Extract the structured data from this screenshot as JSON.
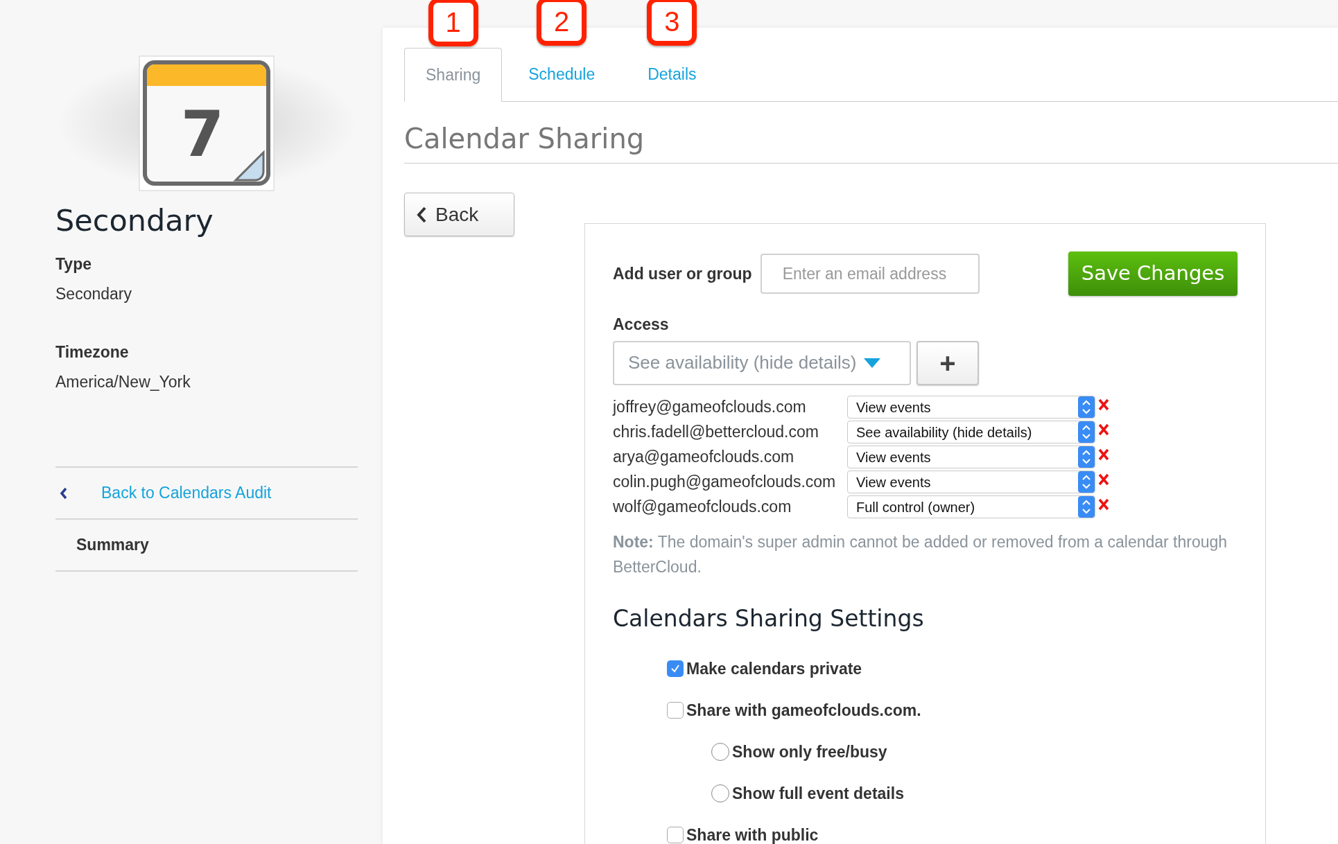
{
  "sidebar": {
    "icon_day": "7",
    "title": "Secondary",
    "fields": [
      {
        "label": "Type",
        "value": "Secondary"
      },
      {
        "label": "Timezone",
        "value": "America/New_York"
      }
    ],
    "nav": [
      {
        "kind": "back",
        "label": "Back to Calendars Audit"
      },
      {
        "kind": "item",
        "label": "Summary"
      }
    ]
  },
  "tabs": [
    {
      "label": "Sharing",
      "step": "1",
      "selected": true
    },
    {
      "label": "Schedule",
      "step": "2",
      "selected": false
    },
    {
      "label": "Details",
      "step": "3",
      "selected": false
    }
  ],
  "heading": "Calendar Sharing",
  "back_button": "Back",
  "form": {
    "add_label": "Add user or group",
    "email_placeholder": "Enter an email address",
    "save_button": "Save Changes",
    "access_label": "Access",
    "access_value": "See availability (hide details)",
    "add_button": "+",
    "shares": [
      {
        "email": "joffrey@gameofclouds.com",
        "access": "View events"
      },
      {
        "email": "chris.fadell@bettercloud.com",
        "access": "See availability (hide details)"
      },
      {
        "email": "arya@gameofclouds.com",
        "access": "View events"
      },
      {
        "email": "colin.pugh@gameofclouds.com",
        "access": "View events"
      },
      {
        "email": "wolf@gameofclouds.com",
        "access": "Full control (owner)"
      }
    ],
    "note": "**Note:** The domain's super admin cannot be added or removed from a calendar through BetterCloud.",
    "settings_title": "Calendars Sharing Settings",
    "settings": [
      {
        "kind": "checkbox",
        "label": "Make calendars private",
        "checked": true
      },
      {
        "kind": "checkbox",
        "label": "Share with gameofclouds.com.",
        "checked": false
      },
      {
        "kind": "radio",
        "label": "Show only free/busy",
        "checked": false
      },
      {
        "kind": "radio",
        "label": "Show full event details",
        "checked": false
      },
      {
        "kind": "checkbox",
        "label": "Share with public",
        "checked": false
      }
    ]
  }
}
